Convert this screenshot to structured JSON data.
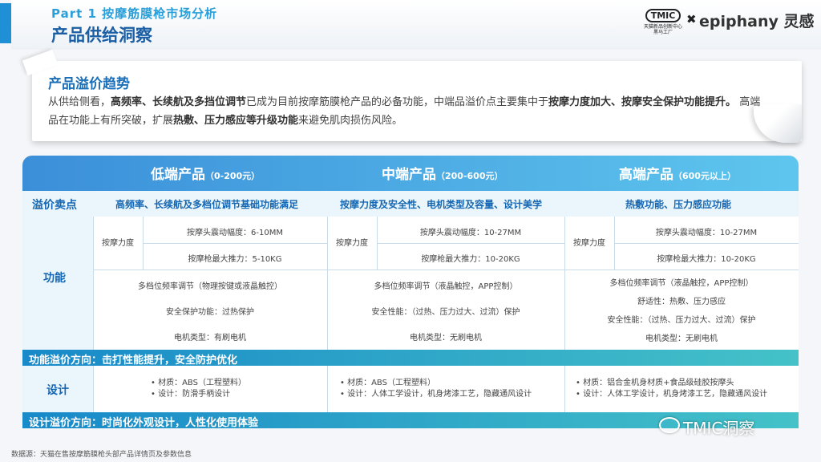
{
  "header": {
    "part": "Part 1 按摩筋膜枪市场分析",
    "title": "产品供给洞察"
  },
  "logos": {
    "tmic_box": "TMIC",
    "tmic_sub1": "天猫新品创新中心",
    "tmic_sub2": "黑马工厂",
    "times": "✖",
    "epiphany": "epiphany 灵感"
  },
  "summary": {
    "title": "产品溢价趋势",
    "seg1": "从供给侧看，",
    "seg2": "高频率、长续航及多挡位调节",
    "seg3": "已成为目前按摩筋膜枪产品的必备功能，中端品溢价点主要集中于",
    "seg4": "按摩力度加大、按摩安全保护功能提升。",
    "seg5": "高端品在功能上有所突破，扩展",
    "seg6": "热敷、压力感应等升级功能",
    "seg7": "来避免肌肉损伤风险。"
  },
  "table": {
    "columns": [
      {
        "name": "低端产品",
        "range": "（0-200元）"
      },
      {
        "name": "中端产品",
        "range": "（200-600元）"
      },
      {
        "name": "高端产品",
        "range": "（600元以上）"
      }
    ],
    "selling_label": "溢价卖点",
    "selling": [
      "高频率、长续航及多档位调节基础功能满足",
      "按摩力度及安全性、电机类型及容量、设计美学",
      "热敷功能、压力感应功能"
    ],
    "function_label": "功能",
    "force_label": "按摩力度",
    "functions": [
      {
        "amp": "按摩头震动幅度：6-10MM",
        "thrust": "按摩枪最大推力：5-10KG",
        "extras": [
          "多档位频率调节（物理按键或液晶触控）",
          "安全保护功能：过热保护",
          "电机类型：有刷电机"
        ]
      },
      {
        "amp": "按摩头震动幅度：10-27MM",
        "thrust": "按摩枪最大推力：10-20KG",
        "extras": [
          "多档位频率调节（液晶触控，APP控制）",
          "安全性能：（过热、压力过大、过流）保护",
          "电机类型：无刷电机"
        ]
      },
      {
        "amp": "按摩头震动幅度：10-27MM",
        "thrust": "按摩枪最大推力：10-20KG",
        "extras": [
          "多档位频率调节（液晶触控，APP控制）",
          "舒适性：热敷、压力感应",
          "安全性能：（过热、压力过大、过流）保护",
          "电机类型：无刷电机"
        ]
      }
    ],
    "function_band": "功能溢价方向：击打性能提升，安全防护优化",
    "design_label": "设计",
    "designs": [
      [
        "•  材质：ABS（工程塑料）",
        "•  设计：防滑手柄设计"
      ],
      [
        "•  材质：ABS（工程塑料）",
        "•  设计：人体工学设计，机身烤漆工艺，隐藏通风设计"
      ],
      [
        "•  材质：铝合金机身材质+食品级硅胶按摩头",
        "•  设计：人体工学设计，机身烤漆工艺，隐藏通风设计"
      ]
    ],
    "design_band": "设计溢价方向：时尚化外观设计，人性化使用体验"
  },
  "footer": {
    "source": "数据源：天猫在售按摩筋膜枪头部产品详情页及参数信息",
    "watermark": "TMIC洞察"
  },
  "colors": {
    "accent": "#1f8fd6",
    "title": "#1b5ea4",
    "band_start": "#1889c9",
    "band_end": "#44c2c8"
  }
}
